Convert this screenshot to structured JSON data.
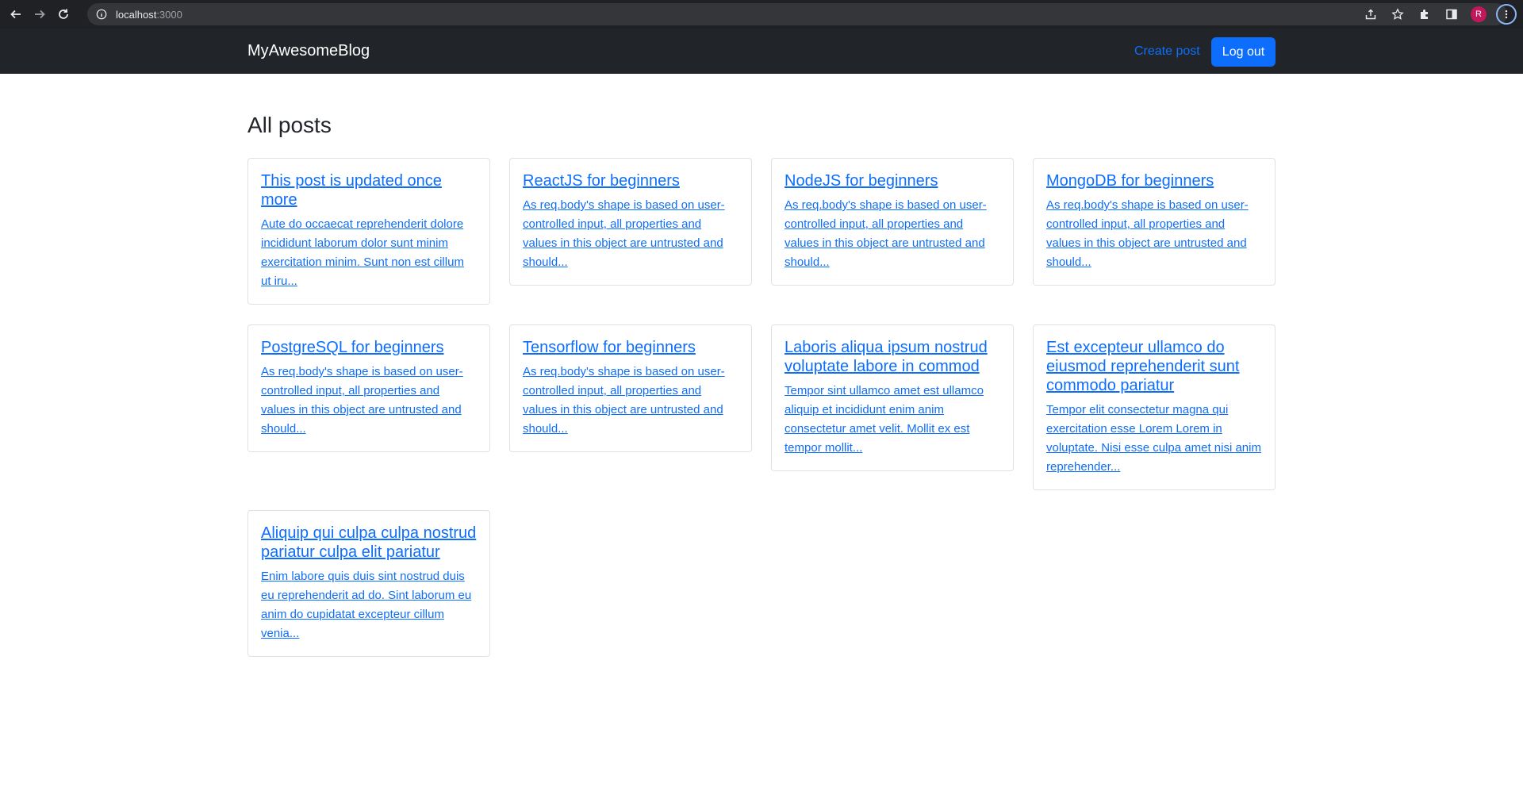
{
  "browser": {
    "url_host": "localhost",
    "url_port": ":3000",
    "profile_initial": "R"
  },
  "navbar": {
    "brand": "MyAwesomeBlog",
    "create_post": "Create post",
    "logout": "Log out"
  },
  "main": {
    "heading": "All posts",
    "posts": [
      {
        "title": "This post is updated once more",
        "excerpt": "Aute do occaecat reprehenderit dolore incididunt laborum dolor sunt minim exercitation minim. Sunt non est cillum ut iru..."
      },
      {
        "title": "ReactJS for beginners",
        "excerpt": "As req.body's shape is based on user-controlled input, all properties and values in this object are untrusted and should..."
      },
      {
        "title": "NodeJS for beginners",
        "excerpt": "As req.body's shape is based on user-controlled input, all properties and values in this object are untrusted and should..."
      },
      {
        "title": "MongoDB for beginners",
        "excerpt": "As req.body's shape is based on user-controlled input, all properties and values in this object are untrusted and should..."
      },
      {
        "title": "PostgreSQL for beginners",
        "excerpt": "As req.body's shape is based on user-controlled input, all properties and values in this object are untrusted and should..."
      },
      {
        "title": "Tensorflow for beginners",
        "excerpt": "As req.body's shape is based on user-controlled input, all properties and values in this object are untrusted and should..."
      },
      {
        "title": "Laboris aliqua ipsum nostrud voluptate labore in commod",
        "excerpt": "Tempor sint ullamco amet est ullamco aliquip et incididunt enim anim consectetur amet velit. Mollit ex est tempor mollit..."
      },
      {
        "title": "Est excepteur ullamco do eiusmod reprehenderit sunt commodo pariatur",
        "excerpt": "Tempor elit consectetur magna qui exercitation esse Lorem Lorem in voluptate. Nisi esse culpa amet nisi anim reprehender..."
      },
      {
        "title": "Aliquip qui culpa culpa nostrud pariatur culpa elit pariatur",
        "excerpt": "Enim labore quis duis sint nostrud duis eu reprehenderit ad do. Sint laborum eu anim do cupidatat excepteur cillum venia..."
      }
    ]
  }
}
